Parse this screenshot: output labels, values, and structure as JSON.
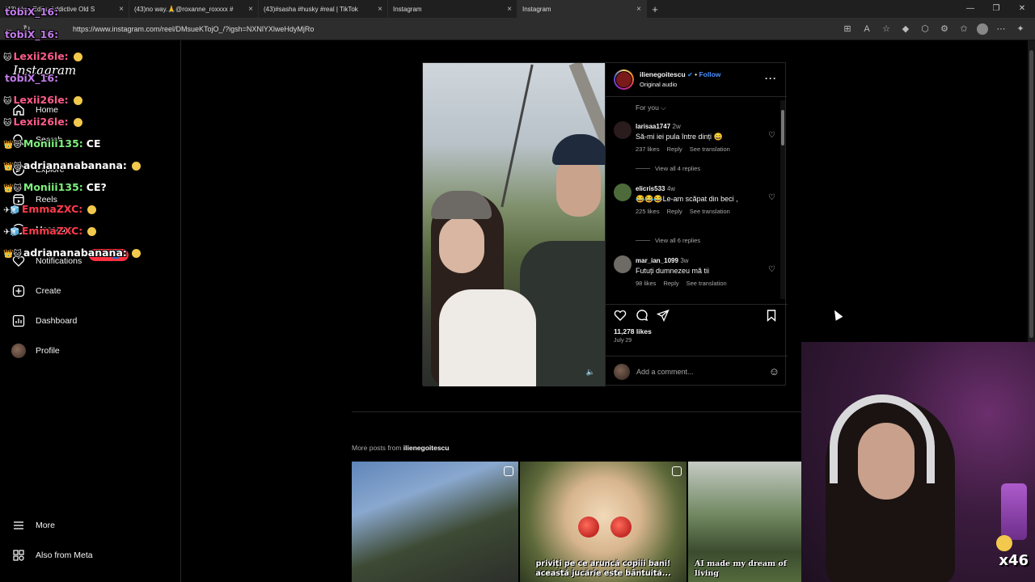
{
  "browser": {
    "tabs": [
      {
        "title": "(43) New Edits: Addictive Old S",
        "active": false
      },
      {
        "title": "(43)no way.🙏@roxanne_roxxxx #",
        "active": false
      },
      {
        "title": "(43)#sasha #husky #real | TikTok",
        "active": false
      },
      {
        "title": "Instagram",
        "active": false
      },
      {
        "title": "Instagram",
        "active": true
      }
    ],
    "new_tab": "+",
    "url": "https://www.instagram.com/reel/DMsueKTojO_/?igsh=NXNlYXlweHdyMjRo",
    "window_controls": [
      "—",
      "❐",
      "✕"
    ]
  },
  "sidebar": {
    "logo": "Instagram",
    "items": [
      {
        "label": "Home",
        "icon": "home-icon"
      },
      {
        "label": "Search",
        "icon": "search-icon"
      },
      {
        "label": "Explore",
        "icon": "compass-icon"
      },
      {
        "label": "Reels",
        "icon": "reels-icon"
      },
      {
        "label": "Messages",
        "icon": "messenger-icon"
      },
      {
        "label": "Notifications",
        "icon": "heart-icon"
      },
      {
        "label": "Create",
        "icon": "plus-icon"
      },
      {
        "label": "Dashboard",
        "icon": "chart-icon"
      },
      {
        "label": "Profile",
        "icon": "avatar"
      }
    ],
    "notification_badge": "❤ 6 👤",
    "more": "More",
    "also_from_meta": "Also from Meta"
  },
  "chat": [
    {
      "user": "tobiX_16:",
      "color": "#c07be8",
      "badges": "",
      "msg": "",
      "emote": false
    },
    {
      "user": "tobiX_16:",
      "color": "#c07be8",
      "badges": "",
      "msg": "",
      "emote": false
    },
    {
      "user": "Lexii26le:",
      "color": "#ff5c8a",
      "badges": "🐱",
      "msg": "",
      "emote": true
    },
    {
      "user": "tobiX_16:",
      "color": "#c07be8",
      "badges": "",
      "msg": "",
      "emote": false
    },
    {
      "user": "Lexii26le:",
      "color": "#ff5c8a",
      "badges": "🐱",
      "msg": "",
      "emote": true
    },
    {
      "user": "Lexii26le:",
      "color": "#ff5c8a",
      "badges": "🐱",
      "msg": "",
      "emote": true
    },
    {
      "user": "Moniii135:",
      "color": "#7df07d",
      "badges": "👑🐱",
      "msg": "CE",
      "emote": false
    },
    {
      "user": "adriananabanana:",
      "color": "#ffffff",
      "badges": "👑🐱",
      "msg": "",
      "emote": true
    },
    {
      "user": "Moniii135:",
      "color": "#7df07d",
      "badges": "👑🐱",
      "msg": "CE?",
      "emote": false
    },
    {
      "user": "EmmaZXC:",
      "color": "#ff3b4a",
      "badges": "✈🧊",
      "msg": "",
      "emote": true
    },
    {
      "user": "EmmaZXC:",
      "color": "#ff3b4a",
      "badges": "✈🧊",
      "msg": "",
      "emote": true
    },
    {
      "user": "adriananabanana:",
      "color": "#ffffff",
      "badges": "👑🐱",
      "msg": "",
      "emote": true
    }
  ],
  "post": {
    "username": "ilienegoitescu",
    "follow": "Follow",
    "audio": "Original audio",
    "for_you": "For you ⌵",
    "comments": [
      {
        "user": "larisaa1747",
        "ago": "2w",
        "text": "Să-mi iei pula între dinți 😄",
        "likes": "237 likes",
        "reply": "Reply",
        "translate": "See translation",
        "replies": "View all 4 replies"
      },
      {
        "user": "elicris533",
        "ago": "4w",
        "text": "😂😂😂Le-am scăpat din beci ,",
        "likes": "225 likes",
        "reply": "Reply",
        "translate": "See translation",
        "replies": "View all 6 replies"
      },
      {
        "user": "mar_ian_1099",
        "ago": "3w",
        "text": "Futuți dumnezeu mă tii",
        "likes": "98 likes",
        "reply": "Reply",
        "translate": "See translation",
        "replies": ""
      }
    ],
    "likes": "11,278 likes",
    "date": "July 29",
    "add_comment_placeholder": "Add a comment..."
  },
  "more_posts": {
    "label": "More posts from",
    "username": "ilienegoitescu",
    "thumbs": [
      {
        "caption": ""
      },
      {
        "caption": "priviți pe ce aruncă copiii bani! această jucărie este bântuită..."
      },
      {
        "caption": "AI made my dream of living"
      }
    ]
  },
  "stream": {
    "gift_count": "x46"
  }
}
